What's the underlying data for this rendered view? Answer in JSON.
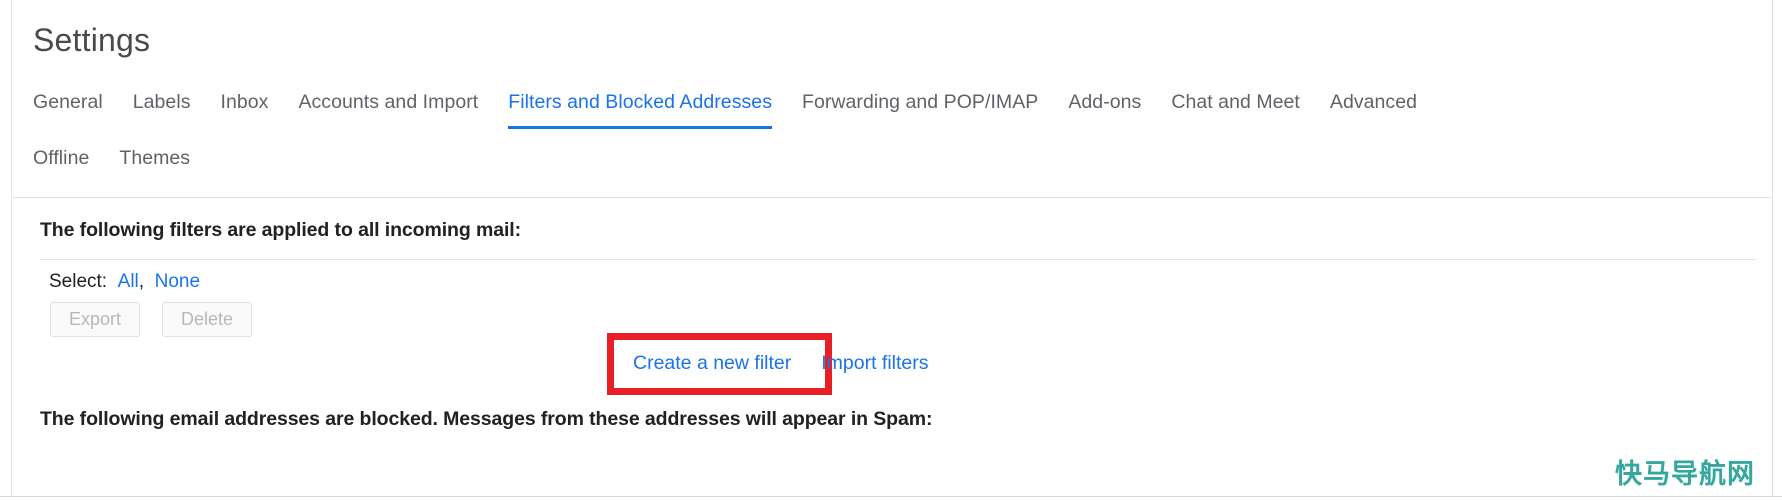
{
  "window": {
    "title": "Settings"
  },
  "tabs": {
    "active": "Filters and Blocked Addresses",
    "row1": [
      {
        "label": "General",
        "active": false
      },
      {
        "label": "Labels",
        "active": false
      },
      {
        "label": "Inbox",
        "active": false
      },
      {
        "label": "Accounts and Import",
        "active": false
      },
      {
        "label": "Filters and Blocked Addresses",
        "active": true
      },
      {
        "label": "Forwarding and POP/IMAP",
        "active": false
      },
      {
        "label": "Add-ons",
        "active": false
      },
      {
        "label": "Chat and Meet",
        "active": false
      },
      {
        "label": "Advanced",
        "active": false
      }
    ],
    "row2": [
      {
        "label": "Offline",
        "active": false
      },
      {
        "label": "Themes",
        "active": false
      }
    ]
  },
  "filters_section": {
    "heading": "The following filters are applied to all incoming mail:",
    "select_label": "Select:",
    "select_all": "All",
    "select_separator": ",",
    "select_none": "None",
    "export_button": "Export",
    "delete_button": "Delete",
    "create_filter_link": "Create a new filter",
    "import_filters_link": "Import filters"
  },
  "blocked_section": {
    "heading": "The following email addresses are blocked. Messages from these addresses will appear in Spam:"
  },
  "watermark": {
    "text": "快马导航网"
  },
  "colors": {
    "accent_blue": "#1a73e8",
    "highlight_red": "#e81f25",
    "text_primary": "#202124",
    "text_secondary": "#5f6368",
    "watermark_teal": "#2aa39a"
  }
}
